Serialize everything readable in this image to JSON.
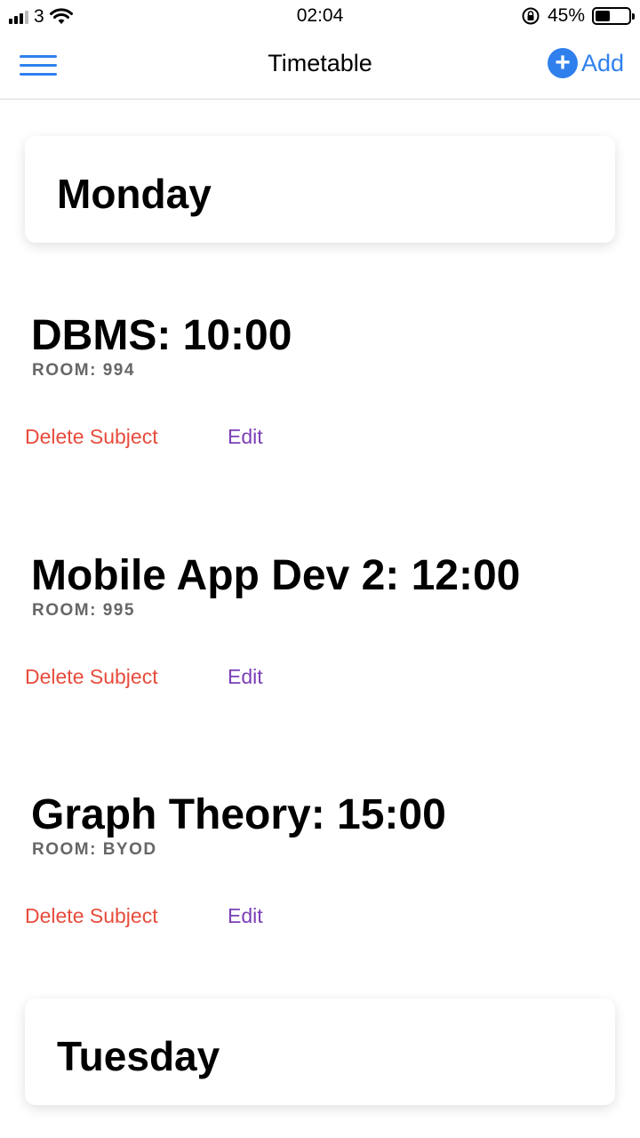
{
  "status_bar": {
    "carrier": "3",
    "time": "02:04",
    "battery_percent": "45%",
    "battery_level": 0.45
  },
  "nav": {
    "title": "Timetable",
    "add_label": "Add",
    "add_icon": "+"
  },
  "days": [
    {
      "name": "Monday",
      "subjects": [
        {
          "title": "DBMS: 10:00",
          "room": "ROOM: 994",
          "delete_label": "Delete Subject",
          "edit_label": "Edit"
        },
        {
          "title": "Mobile App Dev 2: 12:00",
          "room": "ROOM: 995",
          "delete_label": "Delete Subject",
          "edit_label": "Edit"
        },
        {
          "title": "Graph Theory: 15:00",
          "room": "ROOM: BYOD",
          "delete_label": "Delete Subject",
          "edit_label": "Edit"
        }
      ]
    },
    {
      "name": "Tuesday",
      "subjects": []
    }
  ],
  "colors": {
    "accent": "#2f80ed",
    "delete": "#e74c3c",
    "edit": "#7b3fb8"
  }
}
